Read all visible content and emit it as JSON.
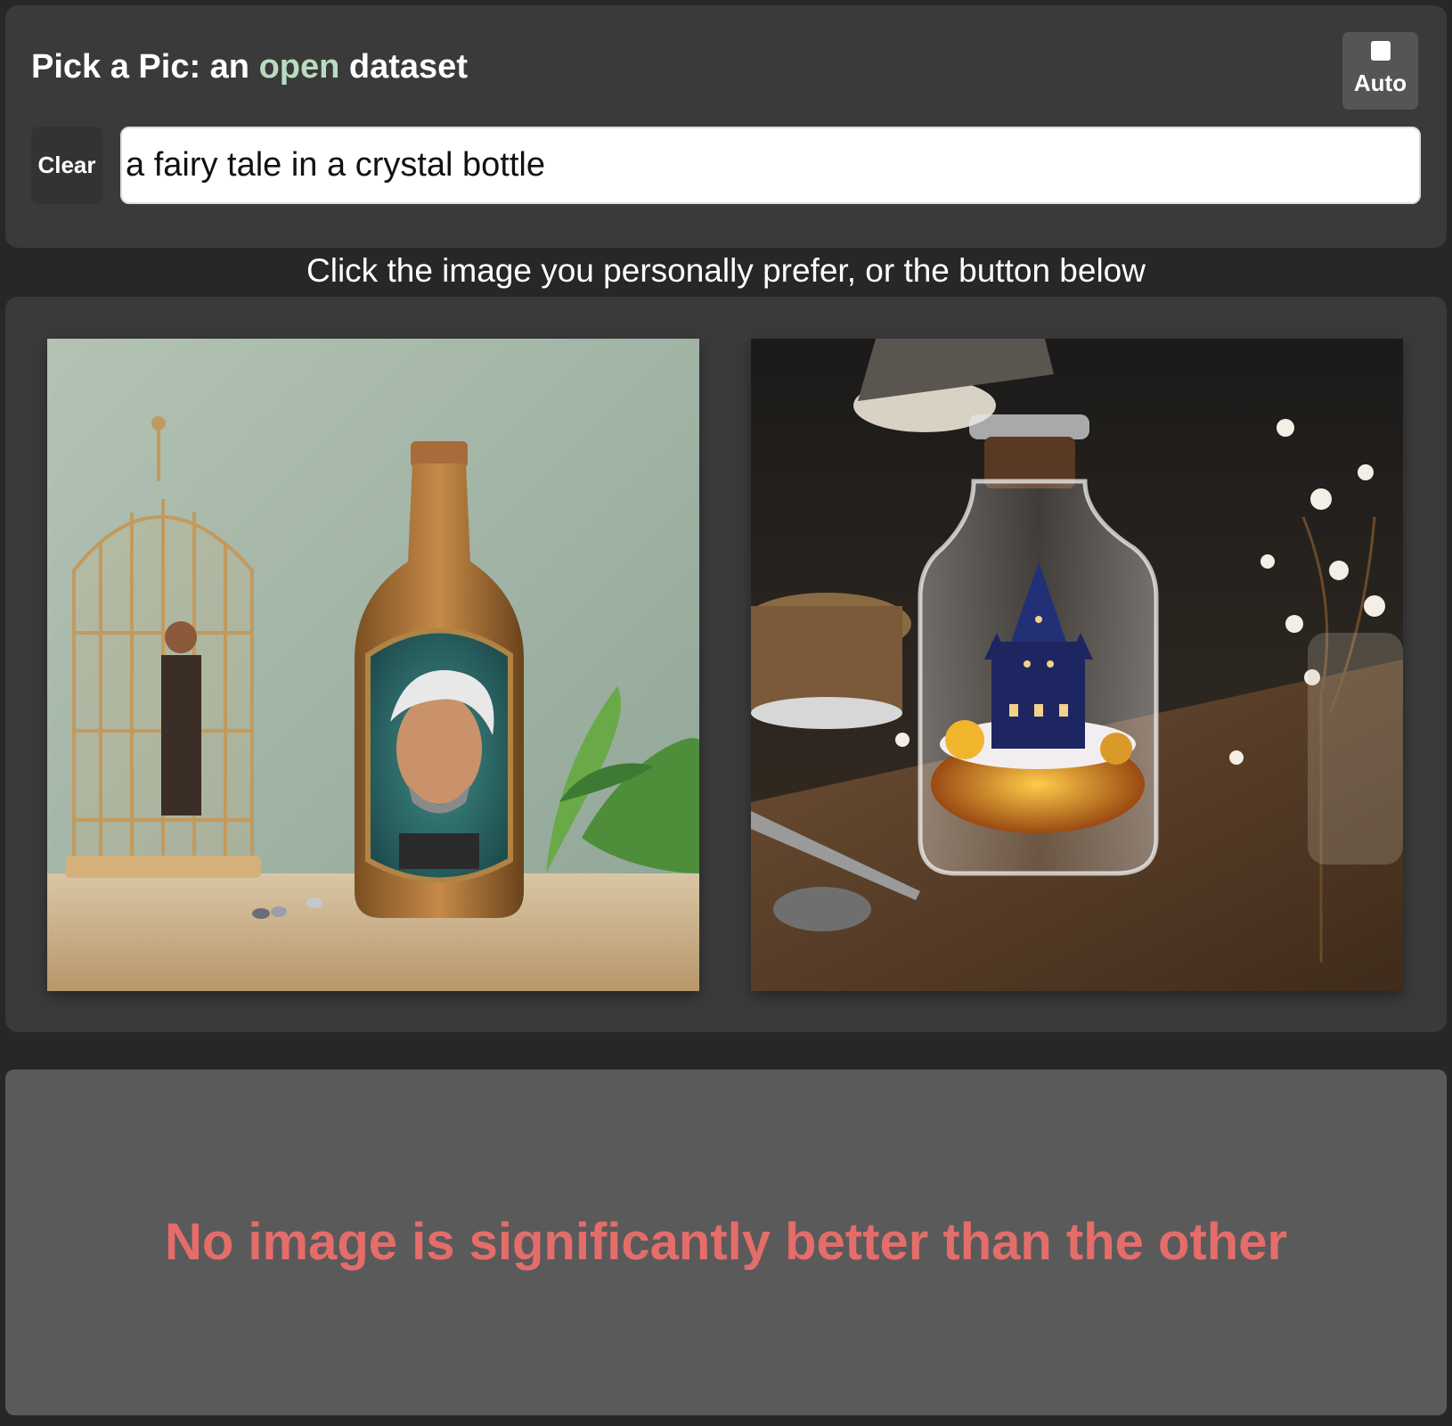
{
  "header": {
    "title_before": "Pick a Pic: an ",
    "title_accent": "open",
    "title_after": " dataset",
    "accent_color": "#b9dcc0"
  },
  "auto_toggle": {
    "label": "Auto",
    "checked": false
  },
  "prompt": {
    "clear_label": "Clear",
    "value": "a fairy tale in a crystal bottle"
  },
  "instruction": "Click the image you personally prefer, or the button below",
  "images": {
    "left": {
      "description_icon": "bottle-portrait-image"
    },
    "right": {
      "description_icon": "castle-in-bottle-image"
    }
  },
  "tie_button": {
    "label": "No image is significantly better than the other",
    "color": "#e46d6a"
  }
}
